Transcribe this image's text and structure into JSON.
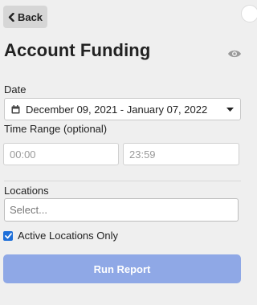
{
  "header": {
    "back_label": "Back",
    "title": "Account Funding"
  },
  "icons": {
    "back": "chevron-left-icon",
    "visibility": "eye-icon",
    "calendar": "calendar-icon",
    "dropdown": "caret-down-icon"
  },
  "date": {
    "label": "Date",
    "value": "December 09, 2021 - January 07, 2022"
  },
  "time_range": {
    "label": "Time Range (optional)",
    "start_placeholder": "00:00",
    "end_placeholder": "23:59"
  },
  "locations": {
    "label": "Locations",
    "placeholder": "Select...",
    "active_only_label": "Active Locations Only",
    "active_only_checked": true
  },
  "actions": {
    "run_label": "Run Report"
  },
  "colors": {
    "background": "#efefef",
    "back_button": "#d6d6d6",
    "run_button_disabled": "#8fa8e6",
    "checkbox": "#1e6fd9"
  }
}
